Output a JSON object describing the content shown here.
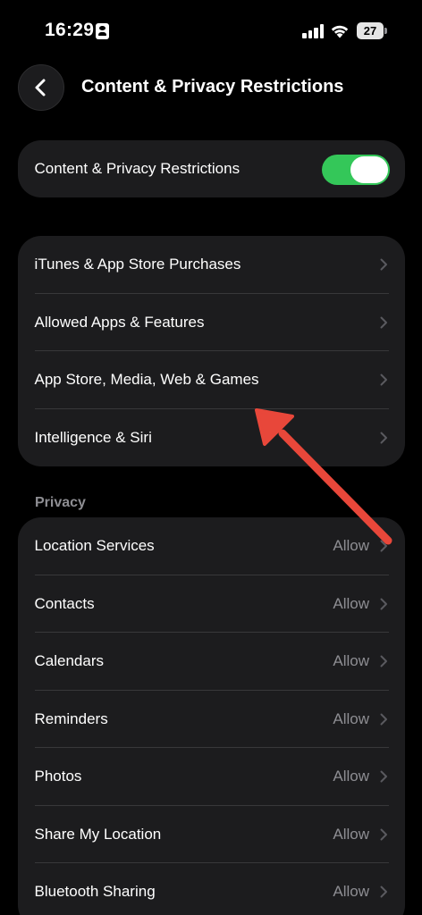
{
  "status_bar": {
    "time": "16:29",
    "battery": "27",
    "icons": [
      "id-card-icon",
      "cellular-signal-icon",
      "wifi-icon",
      "battery-icon"
    ]
  },
  "nav": {
    "back_icon": "chevron-left-icon",
    "title": "Content & Privacy Restrictions"
  },
  "toggle_row": {
    "label": "Content & Privacy Restrictions",
    "state": "on"
  },
  "restrictions": [
    {
      "label": "iTunes & App Store Purchases"
    },
    {
      "label": "Allowed Apps & Features"
    },
    {
      "label": "App Store, Media, Web & Games"
    },
    {
      "label": "Intelligence & Siri"
    }
  ],
  "privacy": {
    "header": "Privacy",
    "items": [
      {
        "label": "Location Services",
        "value": "Allow"
      },
      {
        "label": "Contacts",
        "value": "Allow"
      },
      {
        "label": "Calendars",
        "value": "Allow"
      },
      {
        "label": "Reminders",
        "value": "Allow"
      },
      {
        "label": "Photos",
        "value": "Allow"
      },
      {
        "label": "Share My Location",
        "value": "Allow"
      },
      {
        "label": "Bluetooth Sharing",
        "value": "Allow"
      }
    ]
  },
  "colors": {
    "background": "#000000",
    "card": "#1c1c1e",
    "toggle_on": "#34c759",
    "secondary_text": "#8e8e93",
    "annotation_arrow": "#e8473a"
  }
}
